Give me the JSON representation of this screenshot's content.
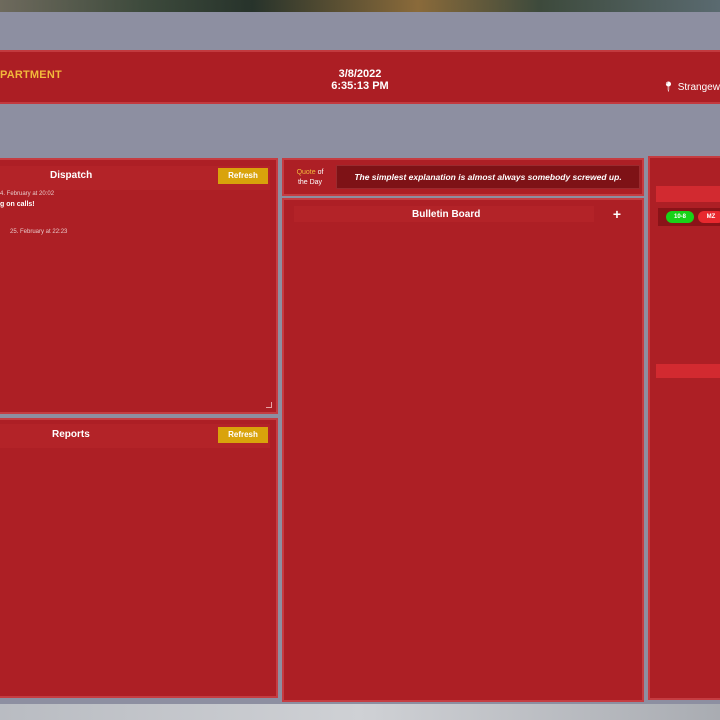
{
  "header": {
    "department": "PARTMENT",
    "date": "3/8/2022",
    "time": "6:35:13 PM",
    "location": "Strangewa"
  },
  "dispatch": {
    "title": "Dispatch",
    "refresh_label": "Refresh",
    "calls": [
      {
        "meta": "4. February at 20:02",
        "text": "g on calls!"
      },
      {
        "meta": "25. February at 22:23",
        "text": ""
      }
    ]
  },
  "reports": {
    "title": "Reports",
    "refresh_label": "Refresh"
  },
  "quote": {
    "label_highlight": "Quote",
    "label_rest_1": "of",
    "label_rest_2": "the Day",
    "text": "The simplest explanation is almost always somebody screwed up."
  },
  "bulletin": {
    "title": "Bulletin Board",
    "add_label": "+"
  },
  "units": {
    "status_1": "10-8",
    "status_2": "MZ"
  },
  "colors": {
    "panel_red": "#ad1f25",
    "accent_gold": "#d9a30b",
    "status_green": "#18d218",
    "status_red": "#e8282e"
  }
}
